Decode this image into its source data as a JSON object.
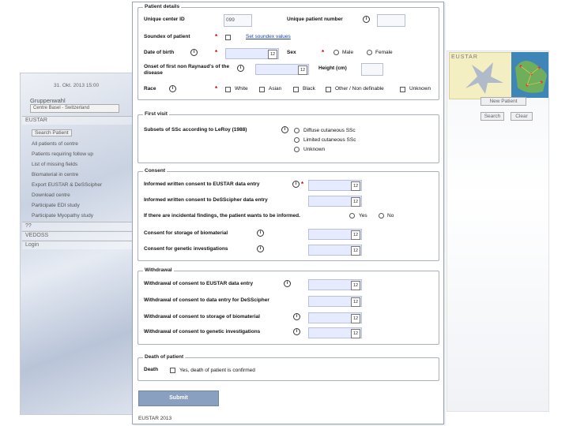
{
  "background_window": {
    "date": "31. Okt. 2013 15:00",
    "group_label": "Gruppenwahl",
    "group_select": "Centre Basel - Switzerland",
    "section_eustar": "EUSTAR",
    "menu_items": [
      "Search Patient",
      "All patients of centre",
      "Patients requiring follow up",
      "List of missing fields",
      "Biomaterial in centre",
      "Export EUSTAR & DeSScipher",
      "Download centre",
      "Participate EDI study",
      "Participate Myopathy study"
    ],
    "section_other": "??",
    "section_vedoss": "VEDOSS",
    "section_login": "Login"
  },
  "right_window": {
    "logo_text": "EUSTAR",
    "new_patient_btn": "New Patient",
    "search_btn": "Search",
    "clear_btn": "Clear"
  },
  "patient_details": {
    "legend": "Patient details",
    "unique_center_id_label": "Unique center ID",
    "unique_center_id_value": "099",
    "unique_patient_number_label": "Unique patient number",
    "soundex_label": "Soundex of patient",
    "soundex_link": "Set soundex values",
    "dob_label": "Date of birth",
    "sex_label": "Sex",
    "sex_options": [
      "Male",
      "Female"
    ],
    "onset_label": "Onset of first non Raynaud's of the disease",
    "height_label": "Height (cm)",
    "race_label": "Race",
    "race_options": [
      "White",
      "Asian",
      "Black",
      "Other / Non definable",
      "Unknown"
    ]
  },
  "first_visit": {
    "legend": "First visit",
    "subsets_label": "Subsets of SSc according to LeRoy (1988)",
    "subsets_options": [
      "Diffuse cutaneous SSc",
      "Limited cutaneous SSc",
      "Unknown"
    ]
  },
  "consent": {
    "legend": "Consent",
    "written_eustar_label": "Informed written consent to EUSTAR data entry",
    "written_desscipher_label": "Informed written consent to DeSScipher data entry",
    "incidental_label": "If there are incidental findings, the patient wants to be informed.",
    "incidental_options": [
      "Yes",
      "No"
    ],
    "storage_label": "Consent for storage of biomaterial",
    "genetic_label": "Consent for genetic investigations"
  },
  "withdrawal": {
    "legend": "Withdrawal",
    "eustar_label": "Withdrawal of consent to EUSTAR data entry",
    "desscipher_label": "Withdrawal of consent to data entry for DeSScipher",
    "storage_label": "Withdrawal of consent to storage of biomaterial",
    "genetic_label": "Withdrawal of consent to genetic investigations"
  },
  "death": {
    "legend": "Death of patient",
    "death_label": "Death",
    "death_option": "Yes, death of patient is confirmed"
  },
  "calendar_icon_text": "12",
  "info_icon_text": "i",
  "required_mark": "*",
  "submit_label": "Submit",
  "footer": "EUSTAR 2013"
}
